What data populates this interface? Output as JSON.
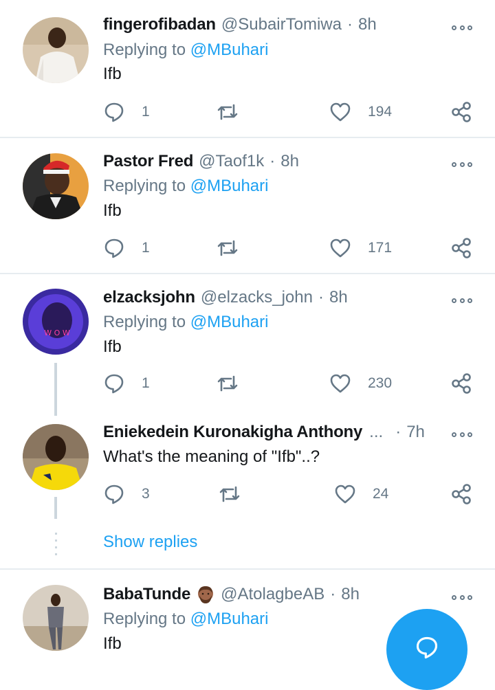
{
  "colors": {
    "accent": "#1da1f2",
    "muted": "#657786",
    "divider": "#e6ecf0",
    "text": "#14171a"
  },
  "tweets": [
    {
      "name": "fingerofibadan",
      "handle": "@SubairTomiwa",
      "sep": "·",
      "time": "8h",
      "replying_prefix": "Replying to ",
      "replying_handle": "@MBuhari",
      "text": "Ifb",
      "replies": "1",
      "likes": "194"
    },
    {
      "name": "Pastor Fred",
      "handle": "@Taof1k",
      "sep": "·",
      "time": "8h",
      "replying_prefix": "Replying to ",
      "replying_handle": "@MBuhari",
      "text": "Ifb",
      "replies": "1",
      "likes": "171"
    },
    {
      "name": "elzacksjohn",
      "handle": "@elzacks_john",
      "sep": "·",
      "time": "8h",
      "replying_prefix": "Replying to ",
      "replying_handle": "@MBuhari",
      "text": "Ifb",
      "replies": "1",
      "likes": "230"
    },
    {
      "name": "Eniekedein Kuronakigha Anthony",
      "name_overflow": "...",
      "sep": "·",
      "time": "7h",
      "text": "What's the meaning of \"Ifb\"..?",
      "replies": "3",
      "likes": "24"
    },
    {
      "name": "BabaTunde",
      "handle": "@AtolagbeAB",
      "sep": "·",
      "time": "8h",
      "replying_prefix": "Replying to ",
      "replying_handle": "@MBuhari",
      "text": "Ifb"
    }
  ],
  "show_replies": "Show replies",
  "icons": {
    "reply": "reply-bubble-icon",
    "retweet": "retweet-icon",
    "like": "heart-icon",
    "share": "share-icon",
    "more": "more-options-icon",
    "emoji": "bearded-man-emoji-icon",
    "compose": "compose-reply-icon"
  }
}
